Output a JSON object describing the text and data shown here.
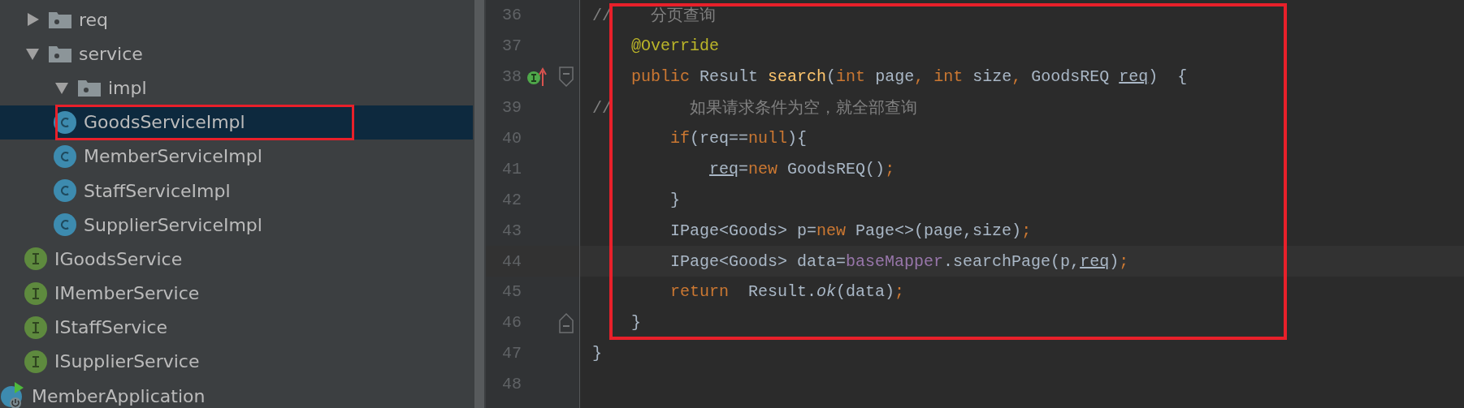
{
  "project_tree": {
    "items": [
      {
        "label": "req",
        "kind": "folder",
        "expanded": false,
        "selected": false,
        "marked": false
      },
      {
        "label": "service",
        "kind": "folder",
        "expanded": true,
        "selected": false,
        "marked": false,
        "children": [
          {
            "label": "impl",
            "kind": "folder",
            "expanded": true,
            "selected": false,
            "marked": false,
            "children": [
              {
                "label": "GoodsServiceImpl",
                "kind": "class",
                "selected": true,
                "marked": true
              },
              {
                "label": "MemberServiceImpl",
                "kind": "class",
                "selected": false,
                "marked": false
              },
              {
                "label": "StaffServiceImpl",
                "kind": "class",
                "selected": false,
                "marked": false
              },
              {
                "label": "SupplierServiceImpl",
                "kind": "class",
                "selected": false,
                "marked": false
              }
            ]
          },
          {
            "label": "IGoodsService",
            "kind": "interface",
            "selected": false,
            "marked": false
          },
          {
            "label": "IMemberService",
            "kind": "interface",
            "selected": false,
            "marked": false
          },
          {
            "label": "IStaffService",
            "kind": "interface",
            "selected": false,
            "marked": false
          },
          {
            "label": "ISupplierService",
            "kind": "interface",
            "selected": false,
            "marked": false
          }
        ]
      },
      {
        "label": "MemberApplication",
        "kind": "application",
        "selected": false,
        "marked": false
      }
    ]
  },
  "editor": {
    "framed_lines": [
      {
        "number": "36",
        "current": false,
        "tokens": [
          {
            "kind": "comment",
            "text": "//    分页查询"
          }
        ]
      },
      {
        "number": "37",
        "current": false,
        "tokens": [
          {
            "kind": "annotation",
            "text": "    @Override"
          }
        ]
      },
      {
        "number": "38",
        "current": false,
        "markers": [
          {
            "kind": "implements"
          },
          {
            "kind": "fold_start"
          }
        ],
        "tokens": [
          {
            "kind": "keyword",
            "text": "    public"
          },
          {
            "kind": "plain",
            "text": " Result "
          },
          {
            "kind": "method",
            "text": "search"
          },
          {
            "kind": "plain",
            "text": "("
          },
          {
            "kind": "keyword",
            "text": "int"
          },
          {
            "kind": "plain",
            "text": " page"
          },
          {
            "kind": "keyword",
            "text": ", int"
          },
          {
            "kind": "plain",
            "text": " size"
          },
          {
            "kind": "keyword",
            "text": ","
          },
          {
            "kind": "plain",
            "text": " GoodsREQ "
          },
          {
            "kind": "param",
            "text": "req"
          },
          {
            "kind": "plain",
            "text": ")  {"
          }
        ]
      },
      {
        "number": "39",
        "current": false,
        "tokens": [
          {
            "kind": "comment",
            "text": "//        如果请求条件为空，就全部查询"
          }
        ]
      },
      {
        "number": "40",
        "current": false,
        "tokens": [
          {
            "kind": "keyword",
            "text": "        if"
          },
          {
            "kind": "plain",
            "text": "(req=="
          },
          {
            "kind": "keyword",
            "text": "null"
          },
          {
            "kind": "plain",
            "text": "){"
          }
        ]
      },
      {
        "number": "41",
        "current": false,
        "tokens": [
          {
            "kind": "param",
            "text": "            req"
          },
          {
            "kind": "plain",
            "text": "="
          },
          {
            "kind": "keyword",
            "text": "new"
          },
          {
            "kind": "plain",
            "text": " GoodsREQ()"
          },
          {
            "kind": "keyword",
            "text": ";"
          }
        ]
      },
      {
        "number": "42",
        "current": false,
        "tokens": [
          {
            "kind": "plain",
            "text": "        }"
          }
        ]
      },
      {
        "number": "43",
        "current": false,
        "tokens": [
          {
            "kind": "plain",
            "text": "        IPage<Goods> p="
          },
          {
            "kind": "keyword",
            "text": "new"
          },
          {
            "kind": "plain",
            "text": " Page<>(page,size)"
          },
          {
            "kind": "keyword",
            "text": ";"
          }
        ]
      },
      {
        "number": "44",
        "current": true,
        "tokens": [
          {
            "kind": "plain",
            "text": "        IPage<Goods> data="
          },
          {
            "kind": "field",
            "text": "baseMapper"
          },
          {
            "kind": "plain",
            "text": ".searchPage(p,"
          },
          {
            "kind": "param",
            "text": "req"
          },
          {
            "kind": "plain",
            "text": ")"
          },
          {
            "kind": "keyword",
            "text": ";"
          }
        ]
      },
      {
        "number": "45",
        "current": false,
        "tokens": [
          {
            "kind": "keyword",
            "text": "        return"
          },
          {
            "kind": "plain",
            "text": "  Result."
          },
          {
            "kind": "static",
            "text": "ok"
          },
          {
            "kind": "plain",
            "text": "(data)"
          },
          {
            "kind": "keyword",
            "text": ";"
          }
        ]
      },
      {
        "number": "46",
        "current": false,
        "markers": [
          {
            "kind": "fold_end"
          }
        ],
        "tokens": [
          {
            "kind": "plain",
            "text": "    }"
          }
        ]
      }
    ],
    "lines": [
      {
        "number": "47",
        "current": false,
        "tokens": [
          {
            "kind": "plain",
            "text": "}"
          }
        ]
      },
      {
        "number": "48"
      }
    ]
  }
}
